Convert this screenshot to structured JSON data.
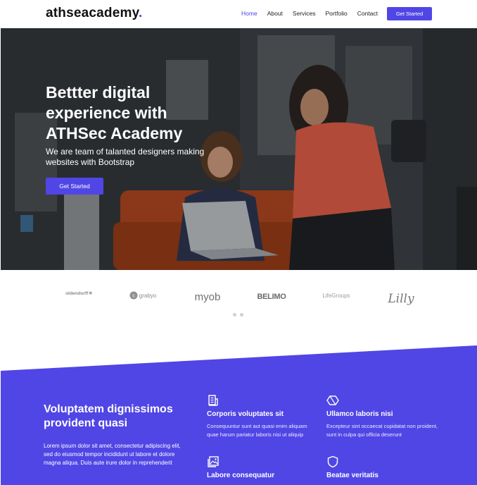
{
  "header": {
    "logo_text": "athseacademy",
    "logo_dot": ".",
    "nav": [
      "Home",
      "About",
      "Services",
      "Portfolio",
      "Contact"
    ],
    "active_nav": "Home",
    "cta_label": "Get Started"
  },
  "hero": {
    "title": "Bettter digital experience with ATHSec Academy",
    "subtitle": "We are team of talanted designers making websites with Bootstrap",
    "cta_label": "Get Started"
  },
  "clients": {
    "logos": [
      "oldendorff",
      "grabyo",
      "myob",
      "BELIMO",
      "LifeGroups",
      "Lilly"
    ],
    "active_slide": 0,
    "slide_count": 2
  },
  "features": {
    "title": "Voluptatem dignissimos provident quasi",
    "text": "Lorem ipsum dolor sit amet, consectetur adipiscing elit, sed do eiusmod tempor incididunt ut labore et dolore magna aliqua. Duis aute irure dolor in reprehenderit",
    "items": [
      {
        "icon": "receipt-icon",
        "title": "Corporis voluptates sit",
        "text": "Consequuntur sunt aut quasi enim aliquam quae harum pariatur laboris nisi ut aliquip"
      },
      {
        "icon": "cube-icon",
        "title": "Ullamco laboris nisi",
        "text": "Excepteur sint occaecat cupidatat non proident, sunt in culpa qui officia deserunt"
      },
      {
        "icon": "image-icon",
        "title": "Labore consequatur",
        "text": ""
      },
      {
        "icon": "shield-icon",
        "title": "Beatae veritatis",
        "text": ""
      }
    ]
  },
  "colors": {
    "accent": "#5046e5",
    "text_dark": "#222222",
    "hero_overlay": "#1c1f24"
  }
}
